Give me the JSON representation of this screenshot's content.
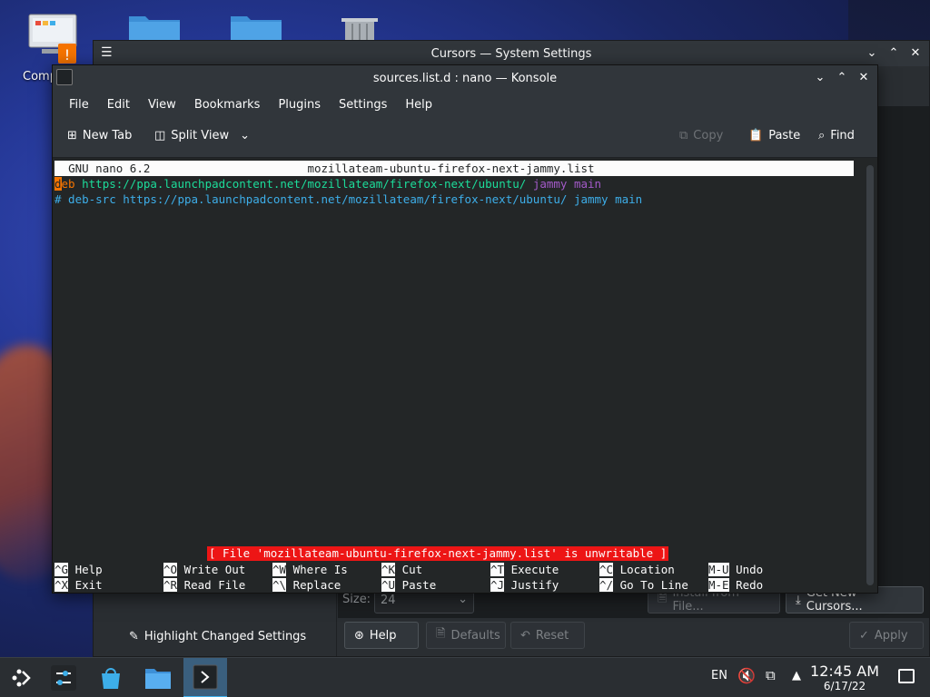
{
  "desktop": {
    "icon_label_computer": "Comp"
  },
  "settings_window": {
    "title": "Cursors — System Settings",
    "size_label": "Size:",
    "size_value": "24",
    "install_button": "Install from File...",
    "get_new_button": "Get New Cursors...",
    "highlight_button": "Highlight Changed Settings",
    "help_button": "Help",
    "defaults_button": "Defaults",
    "reset_button": "Reset",
    "apply_button": "Apply"
  },
  "konsole": {
    "title": "sources.list.d : nano — Konsole",
    "menu": [
      "File",
      "Edit",
      "View",
      "Bookmarks",
      "Plugins",
      "Settings",
      "Help"
    ],
    "toolbar": {
      "new_tab": "New Tab",
      "split_view": "Split View",
      "copy": "Copy",
      "paste": "Paste",
      "find": "Find"
    },
    "nano": {
      "version": "GNU nano 6.2",
      "filename": "mozillateam-ubuntu-firefox-next-jammy.list",
      "line1_cursor": "d",
      "line1_deb": "eb",
      "line1_url": "https://ppa.launchpadcontent.net/mozillateam/firefox-next/ubuntu/",
      "line1_suite": "jammy main",
      "line2": "# deb-src https://ppa.launchpadcontent.net/mozillateam/firefox-next/ubuntu/ jammy main",
      "status": "[ File 'mozillateam-ubuntu-firefox-next-jammy.list' is unwritable ]",
      "shortcuts_row1": [
        {
          "key": "^G",
          "label": "Help"
        },
        {
          "key": "^O",
          "label": "Write Out"
        },
        {
          "key": "^W",
          "label": "Where Is"
        },
        {
          "key": "^K",
          "label": "Cut"
        },
        {
          "key": "^T",
          "label": "Execute"
        },
        {
          "key": "^C",
          "label": "Location"
        },
        {
          "key": "M-U",
          "label": "Undo"
        }
      ],
      "shortcuts_row2": [
        {
          "key": "^X",
          "label": "Exit"
        },
        {
          "key": "^R",
          "label": "Read File"
        },
        {
          "key": "^\\",
          "label": "Replace"
        },
        {
          "key": "^U",
          "label": "Paste"
        },
        {
          "key": "^J",
          "label": "Justify"
        },
        {
          "key": "^/",
          "label": "Go To Line"
        },
        {
          "key": "M-E",
          "label": "Redo"
        }
      ]
    }
  },
  "taskbar": {
    "lang": "EN",
    "time": "12:45 AM",
    "date": "6/17/22"
  },
  "colors": {
    "accent": "#3daee9",
    "window_bg": "#31363b",
    "terminal_bg": "#232627",
    "error": "#ed1515",
    "nano_green": "#1cdc9a",
    "nano_purple": "#a35ac8",
    "cursor": "#f67400"
  }
}
